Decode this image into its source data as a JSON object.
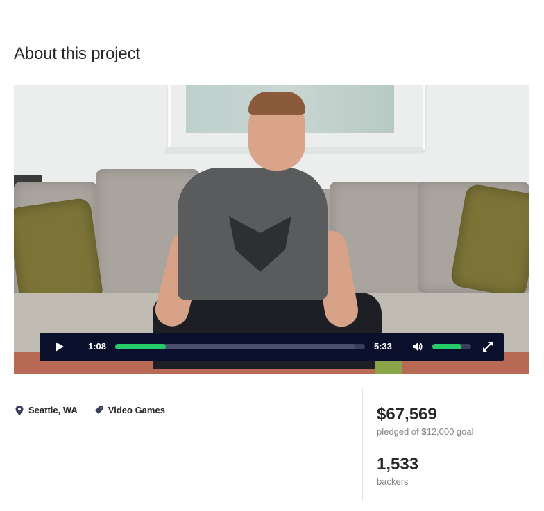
{
  "page": {
    "title": "About this project"
  },
  "video": {
    "current_time": "1:08",
    "total_time": "5:33",
    "progress_percent": 20.4,
    "buffered_percent": 96,
    "volume_percent": 75
  },
  "meta": {
    "location": "Seattle, WA",
    "category": "Video Games"
  },
  "stats": {
    "pledged_amount": "$67,569",
    "pledged_label": "pledged of $12,000 goal",
    "backers_count": "1,533",
    "backers_label": "backers"
  },
  "colors": {
    "accent": "#25cb68",
    "player_bar": "#0a0f2b",
    "text": "#282828",
    "muted": "#828587"
  },
  "icons": [
    "play-icon",
    "volume-icon",
    "fullscreen-icon",
    "location-pin-icon",
    "tag-icon"
  ]
}
